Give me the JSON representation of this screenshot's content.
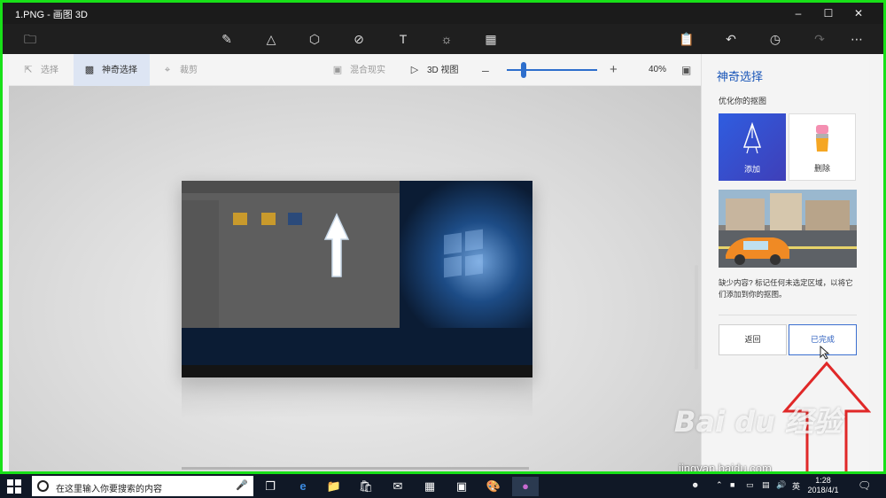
{
  "window": {
    "title": "1.PNG - 画图 3D"
  },
  "colors": {
    "accent": "#2d6ecc",
    "frame_highlight": "#18e018",
    "annotation": "#e02828"
  },
  "toolbar": {
    "left_icons": [
      "folder-icon"
    ],
    "center_icons": [
      "brush-icon",
      "2d-shapes-icon",
      "3d-shapes-icon",
      "stickers-icon",
      "text-icon",
      "effects-icon",
      "canvas-icon"
    ],
    "right_icons": [
      "paste-icon",
      "undo-icon",
      "history-icon",
      "redo-icon",
      "more-icon"
    ]
  },
  "subbar": {
    "select": "选择",
    "magic_select": "神奇选择",
    "crop": "裁剪",
    "mixed_reality": "混合现实",
    "view_3d": "3D 视图",
    "zoom": "40%"
  },
  "panel": {
    "title": "神奇选择",
    "subtitle": "优化你的抠图",
    "add_label": "添加",
    "remove_label": "删除",
    "hint": "缺少内容? 标记任何未选定区域，以将它们添加到你的抠图。",
    "back_button": "返回",
    "done_button": "已完成"
  },
  "watermark": {
    "brand": "Bai du 经验",
    "url": "jingyan.baidu.com"
  },
  "taskbar": {
    "search_placeholder": "在这里输入你要搜索的内容",
    "language": "英",
    "time": "1:28",
    "date": "2018/4/1",
    "apps": [
      "task-view-icon",
      "edge-icon",
      "file-explorer-icon",
      "store-icon",
      "mail-icon",
      "calculator-icon",
      "photos-icon",
      "paint-palette-icon",
      "paint-3d-icon"
    ]
  }
}
